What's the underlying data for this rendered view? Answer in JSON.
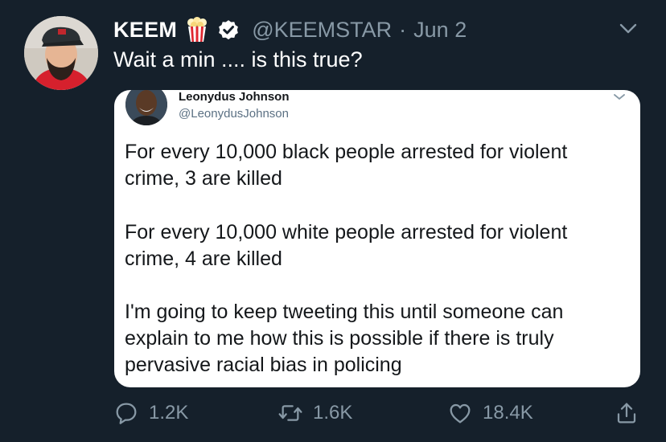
{
  "tweet": {
    "author_name": "KEEM",
    "author_handle": "@KEEMSTAR",
    "separator": "·",
    "date": "Jun 2",
    "text": "Wait a min ....  is this true?"
  },
  "quoted": {
    "author_name": "Leonydus Johnson",
    "author_handle": "@LeonydusJohnson",
    "paragraphs": [
      [
        "For every 10,000 black people arrested for violent",
        "crime, 3 are killed"
      ],
      [
        "For every 10,000 white people arrested for violent",
        "crime, 4 are killed"
      ],
      [
        "I'm going to keep tweeting this until someone can",
        "explain to me how this is possible if there is truly",
        "pervasive racial bias in policing"
      ]
    ]
  },
  "actions": {
    "replies": "1.2K",
    "retweets": "1.6K",
    "likes": "18.4K"
  },
  "icons": {
    "name_emoji": "popcorn-icon",
    "verified": "verified-badge-icon",
    "menu": "chevron-down-icon",
    "reply": "reply-icon",
    "retweet": "retweet-icon",
    "like": "heart-icon",
    "share": "share-icon"
  },
  "colors": {
    "background": "#15202b",
    "secondary_text": "#8899a6",
    "card_background": "#ffffff"
  }
}
